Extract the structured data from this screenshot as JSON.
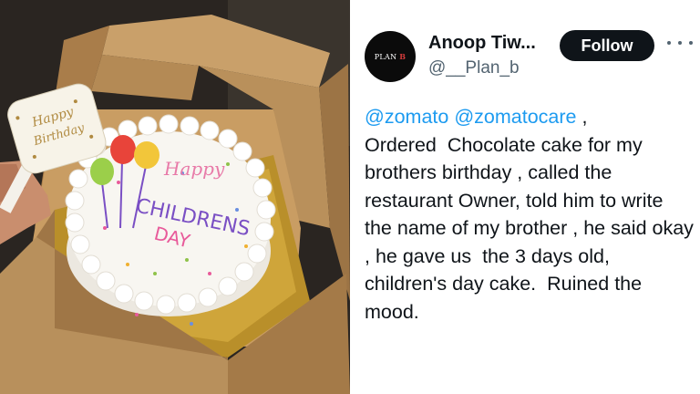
{
  "tweet": {
    "avatar_text": "PLAN",
    "avatar_text_accent": "B",
    "display_name": "Anoop Tiw...",
    "handle": "@__Plan_b",
    "follow_label": "Follow",
    "more_icon": "more-horizontal-icon",
    "mentions": [
      "@zomato",
      "@zomatocare"
    ],
    "text_after_mentions": " ,\nOrdered  Chocolate cake for my brothers birthday , called the restaurant Owner, told him to write the name of my brother , he said okay , he gave us  the 3 days old, children's day cake.  Ruined the mood."
  },
  "photo": {
    "description_label": "cake-photo",
    "cake_text_line1": "Happy",
    "cake_text_line2": "CHILDRENS",
    "cake_text_line3": "DAY",
    "topper_text_line1": "Happy",
    "topper_text_line2": "Birthday"
  },
  "colors": {
    "link": "#1d9bf0",
    "text": "#0f1419",
    "muted": "#536471",
    "button": "#0f1419"
  }
}
